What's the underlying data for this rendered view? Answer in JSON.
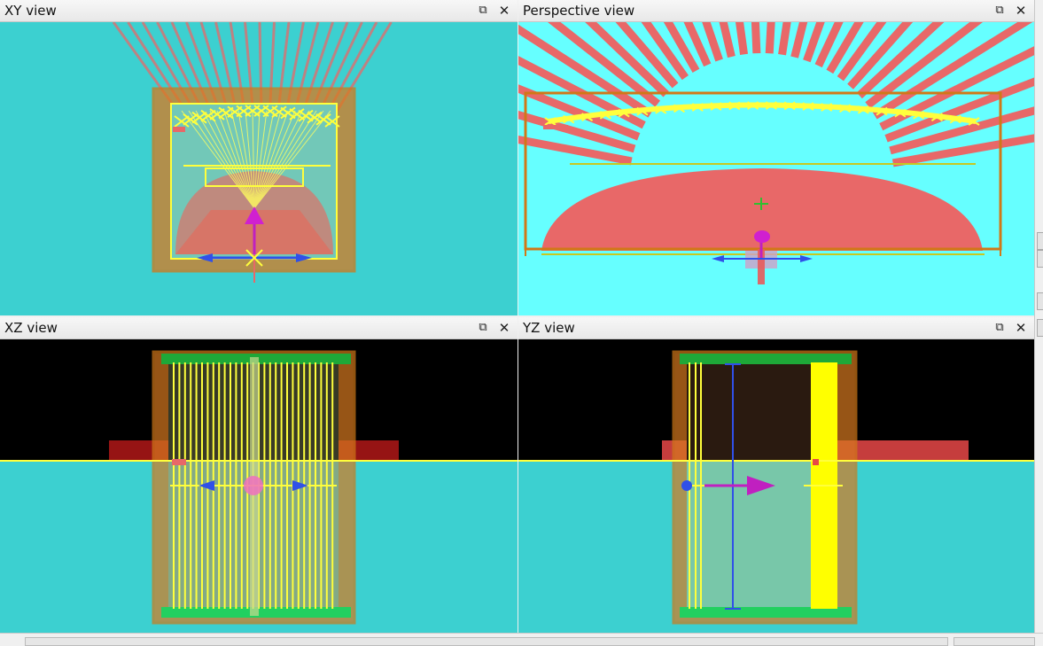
{
  "panes": {
    "xy": {
      "title": "XY view"
    },
    "perspective": {
      "title": "Perspective view"
    },
    "xz": {
      "title": "XZ view"
    },
    "yz": {
      "title": "YZ view"
    }
  },
  "controls": {
    "float_icon": "⧉",
    "close_icon": "✕"
  },
  "colors": {
    "viewport_teal": "#3cd0d0",
    "viewport_cyan": "#66ffff",
    "viewport_black": "#000000",
    "ray_red": "#e86868",
    "frame_orange": "#d07818",
    "outline_yellow": "#ffff3c",
    "gizmo_magenta": "#c020c0",
    "gizmo_blue": "#3050e8",
    "floor_green": "#22d060"
  }
}
